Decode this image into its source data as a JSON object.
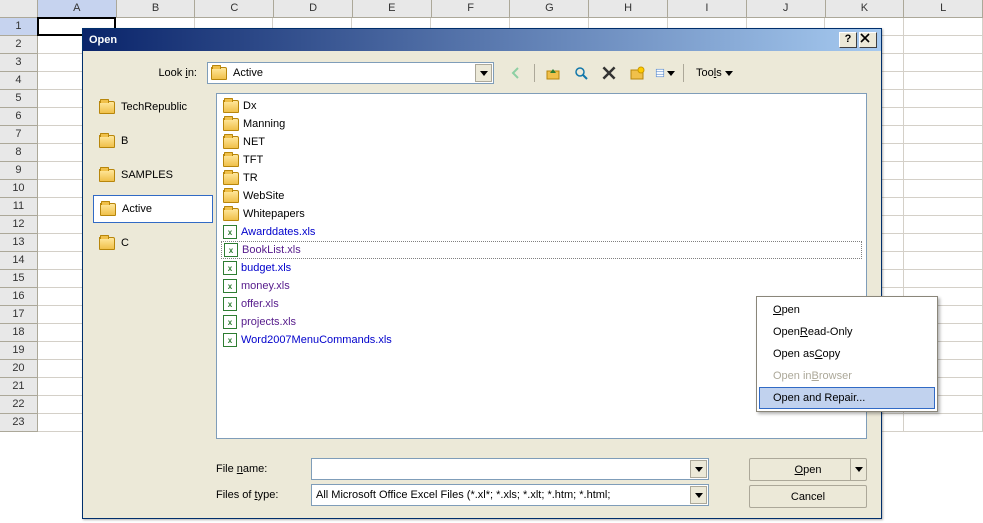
{
  "columns": [
    "A",
    "B",
    "C",
    "D",
    "E",
    "F",
    "G",
    "H",
    "I",
    "J",
    "K",
    "L"
  ],
  "row_count": 23,
  "active_cell": {
    "row": 1,
    "col": "A"
  },
  "dialog": {
    "title": "Open",
    "lookin_label": "Look in:",
    "lookin_value": "Active",
    "tools_label": "Tools",
    "filename_label": "File name:",
    "filename_value": "",
    "filetype_label": "Files of type:",
    "filetype_value": "All Microsoft Office Excel Files (*.xl*; *.xls; *.xlt; *.htm; *.html;",
    "open_btn": "Open",
    "cancel_btn": "Cancel"
  },
  "places": [
    {
      "label": "TechRepublic",
      "selected": false
    },
    {
      "label": "B",
      "selected": false
    },
    {
      "label": "SAMPLES",
      "selected": false
    },
    {
      "label": "Active",
      "selected": true
    },
    {
      "label": "C",
      "selected": false
    }
  ],
  "files": [
    {
      "name": "Dx",
      "type": "folder"
    },
    {
      "name": "Manning",
      "type": "folder"
    },
    {
      "name": "NET",
      "type": "folder"
    },
    {
      "name": "TFT",
      "type": "folder"
    },
    {
      "name": "TR",
      "type": "folder"
    },
    {
      "name": "WebSite",
      "type": "folder"
    },
    {
      "name": "Whitepapers",
      "type": "folder"
    },
    {
      "name": "Awarddates.xls",
      "type": "excel",
      "visited": false
    },
    {
      "name": "BookList.xls",
      "type": "excel",
      "visited": true,
      "selected": true
    },
    {
      "name": "budget.xls",
      "type": "excel",
      "visited": false
    },
    {
      "name": "money.xls",
      "type": "excel",
      "visited": true
    },
    {
      "name": "offer.xls",
      "type": "excel",
      "visited": true
    },
    {
      "name": "projects.xls",
      "type": "excel",
      "visited": true
    },
    {
      "name": "Word2007MenuCommands.xls",
      "type": "excel",
      "visited": false
    }
  ],
  "context_menu": [
    {
      "label": "Open",
      "underline": 0,
      "disabled": false,
      "hover": false
    },
    {
      "label": "Open Read-Only",
      "underline": 5,
      "disabled": false,
      "hover": false
    },
    {
      "label": "Open as Copy",
      "underline": 8,
      "disabled": false,
      "hover": false
    },
    {
      "label": "Open in Browser",
      "underline": 8,
      "disabled": true,
      "hover": false
    },
    {
      "label": "Open and Repair...",
      "underline": -1,
      "disabled": false,
      "hover": true
    }
  ]
}
